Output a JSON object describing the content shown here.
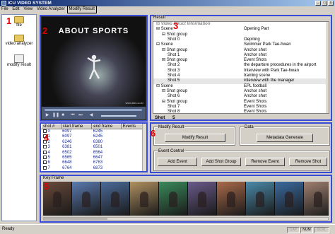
{
  "window": {
    "title": "ICU VIDEO SYSTEM",
    "min": "_",
    "max": "□",
    "close": "x"
  },
  "menu": [
    "File",
    "Edit",
    "View",
    "Video Analyzer",
    "Modify Result"
  ],
  "left_panel": {
    "items": [
      "file",
      "video analyzer",
      "modify result"
    ]
  },
  "region_markers": [
    "1",
    "2",
    "3",
    "4",
    "5",
    "6"
  ],
  "video": {
    "banner": "ABOUT SPORTS",
    "watermark": "www.kbs.co.kr"
  },
  "result": {
    "title": "Result",
    "header": "Video Struct Information",
    "rows": [
      {
        "label": "Scene",
        "value": "Opening Part",
        "level": 0,
        "toggle": "⊟"
      },
      {
        "label": "Shot group",
        "value": "",
        "level": 1,
        "toggle": "⊟"
      },
      {
        "label": "Shot      0",
        "value": "Oepning",
        "level": 2,
        "toggle": ""
      },
      {
        "label": "Scene",
        "value": "Swimmer Park Tae-hwan",
        "level": 0,
        "toggle": "⊟"
      },
      {
        "label": "Shot group",
        "value": "Anchor shot",
        "level": 1,
        "toggle": "⊟"
      },
      {
        "label": "Shot      1",
        "value": "Anchor shot",
        "level": 2,
        "toggle": ""
      },
      {
        "label": "Shot group",
        "value": "Event Shots",
        "level": 1,
        "toggle": "⊟"
      },
      {
        "label": "Shot      2",
        "value": "the departure procedures in the airport",
        "level": 2,
        "toggle": ""
      },
      {
        "label": "Shot      3",
        "value": "Interview with Park Tae-hwan",
        "level": 2,
        "toggle": ""
      },
      {
        "label": "Shot      4",
        "value": "training scene",
        "level": 2,
        "toggle": ""
      },
      {
        "label": "Shot      5",
        "value": "interview with the manager",
        "level": 2,
        "toggle": "",
        "selected": true
      },
      {
        "label": "Scene",
        "value": "EPL football",
        "level": 0,
        "toggle": "⊟"
      },
      {
        "label": "Shot group",
        "value": "Anchor shot",
        "level": 1,
        "toggle": "⊟"
      },
      {
        "label": "Shot      6",
        "value": "Anchor shot",
        "level": 2,
        "toggle": ""
      },
      {
        "label": "Shot group",
        "value": "Event Shots",
        "level": 1,
        "toggle": "⊟"
      },
      {
        "label": "Shot      7",
        "value": "Event Shots",
        "level": 2,
        "toggle": ""
      },
      {
        "label": "Shot      8",
        "value": "Event Shots",
        "level": 2,
        "toggle": ""
      },
      {
        "label": "Shot      9",
        "value": "Event Shots",
        "level": 2,
        "toggle": ""
      }
    ],
    "shot_label": "Shot",
    "shot_value": "5"
  },
  "shot_table": {
    "headers": [
      "shot #",
      "start frame",
      "end frame",
      "Events"
    ],
    "rows": [
      [
        "0",
        "6097",
        "6245",
        ""
      ],
      [
        "1",
        "6097",
        "6245",
        ""
      ],
      [
        "2",
        "6246",
        "6380",
        ""
      ],
      [
        "3",
        "6381",
        "6501",
        ""
      ],
      [
        "4",
        "6502",
        "6564",
        ""
      ],
      [
        "5",
        "6565",
        "6647",
        ""
      ],
      [
        "6",
        "6648",
        "6763",
        ""
      ],
      [
        "7",
        "6764",
        "6873",
        ""
      ]
    ]
  },
  "controls": {
    "modify_result": {
      "title": "Modify Result",
      "button": "Modify Result"
    },
    "data": {
      "title": "Data",
      "button": "Metadata Generate"
    },
    "event_control": {
      "title": "Event Control",
      "buttons": [
        "Add Event",
        "Add Shot Group",
        "Remove Event",
        "Remove Shot"
      ]
    }
  },
  "keyframe": {
    "title": "Key Frame",
    "thumbnails": [
      "#6a4a3a",
      "#5a7ab0",
      "#4a6a9a",
      "#b09060",
      "#3a8a5a",
      "#6a5a8a",
      "#aa6a4a",
      "#4a8aaa",
      "#3a6aa0",
      "#a08070"
    ]
  },
  "status": {
    "text": "Ready",
    "indicators": [
      {
        "label": "CAP",
        "active": false
      },
      {
        "label": "NUM",
        "active": true
      },
      {
        "label": "SCRL",
        "active": false
      }
    ]
  },
  "colors": {
    "title_start": "#0a246a",
    "frame_border": "#3a4bd8",
    "marker": "#dd0000",
    "table_text": "#1a2ca0"
  }
}
